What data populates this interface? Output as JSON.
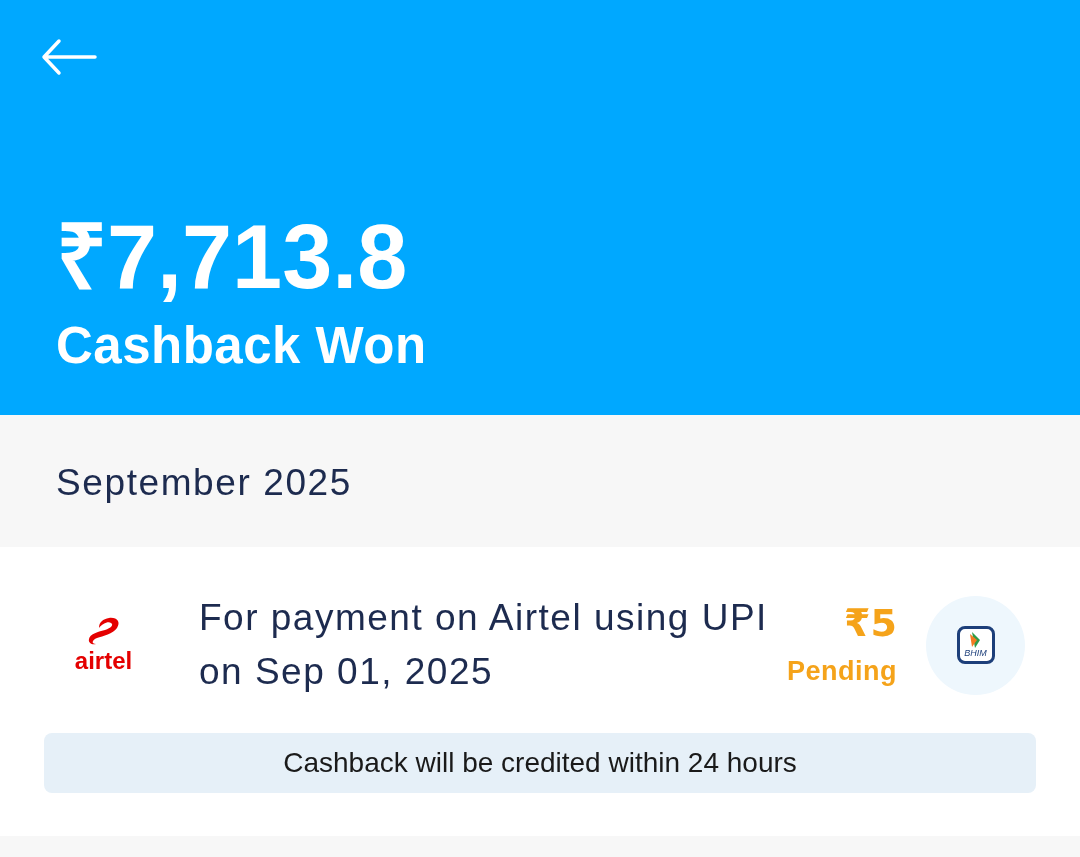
{
  "header": {
    "amount": "₹7,713.8",
    "caption": "Cashback Won"
  },
  "sections": [
    {
      "month": "September 2025",
      "entries": [
        {
          "brand": "airtel",
          "description": [
            "For payment on Airtel using UPI",
            "on Sep 01, 2025"
          ],
          "amount": "₹5",
          "status": "Pending",
          "pending": true,
          "app_name": "BHIM",
          "note": "Cashback will be credited within 24 hours"
        }
      ]
    }
  ]
}
